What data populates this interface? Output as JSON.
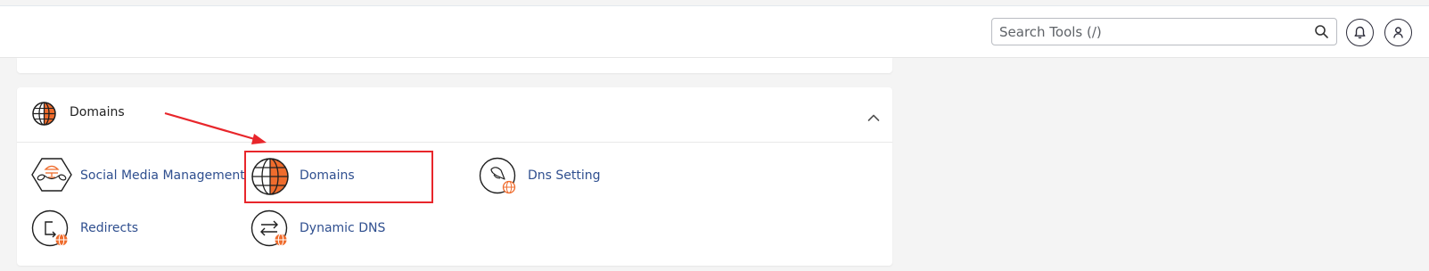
{
  "header": {
    "search_placeholder": "Search Tools (/)"
  },
  "section": {
    "title": "Domains",
    "expanded": true
  },
  "tools": [
    {
      "label": "Social Media Management",
      "icon": "social-media-icon"
    },
    {
      "label": "Domains",
      "icon": "globe-icon"
    },
    {
      "label": "Dns Setting",
      "icon": "dns-setting-icon"
    },
    {
      "label": "Redirects",
      "icon": "redirects-icon"
    },
    {
      "label": "Dynamic DNS",
      "icon": "dynamic-dns-icon"
    }
  ],
  "colors": {
    "accent": "#ef6c2d",
    "link": "#2f4f8f",
    "annotation": "#e8262b"
  }
}
